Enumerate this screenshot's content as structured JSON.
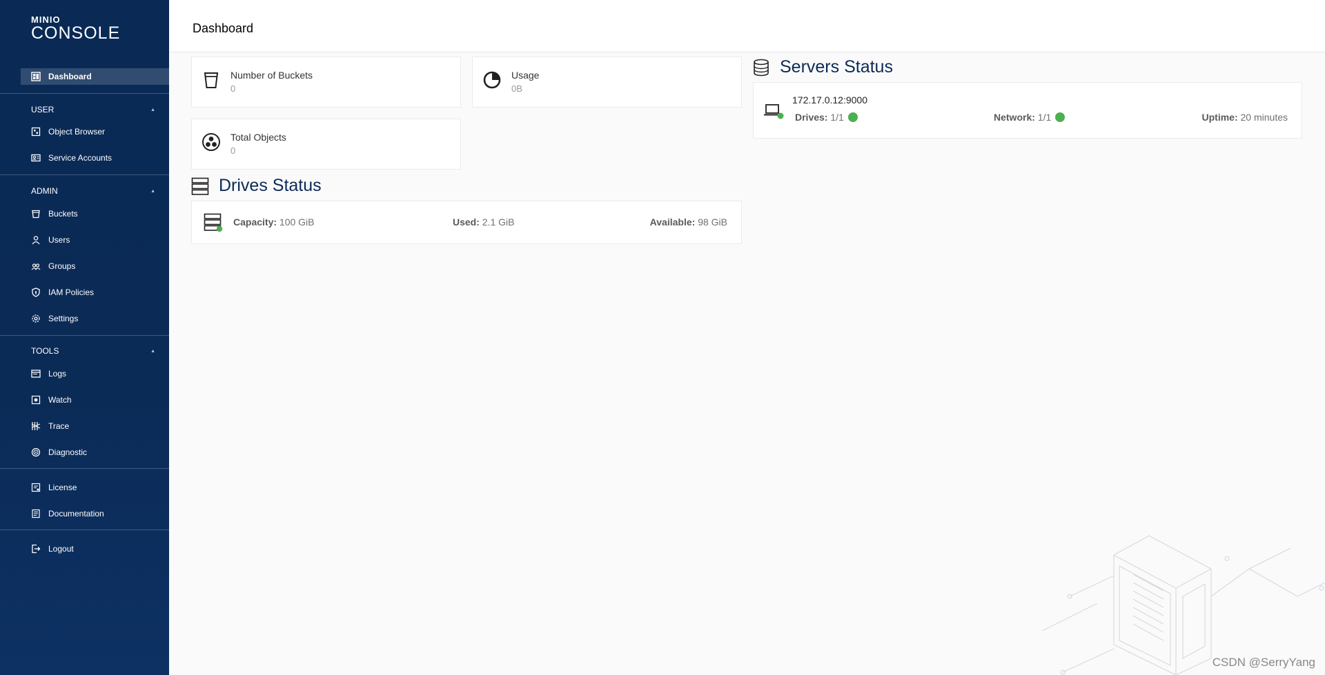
{
  "brand": {
    "small": "MINIO",
    "big": "CONSOLE"
  },
  "page": {
    "title": "Dashboard"
  },
  "sidebar": {
    "dashboard": {
      "label": "Dashboard",
      "icon": "dashboard-icon"
    },
    "sections": {
      "user": {
        "title": "USER",
        "items": [
          {
            "label": "Object Browser",
            "icon": "object-browser-icon"
          },
          {
            "label": "Service Accounts",
            "icon": "service-accounts-icon"
          }
        ]
      },
      "admin": {
        "title": "ADMIN",
        "items": [
          {
            "label": "Buckets",
            "icon": "bucket-icon"
          },
          {
            "label": "Users",
            "icon": "user-icon"
          },
          {
            "label": "Groups",
            "icon": "groups-icon"
          },
          {
            "label": "IAM Policies",
            "icon": "shield-icon"
          },
          {
            "label": "Settings",
            "icon": "gear-icon"
          }
        ]
      },
      "tools": {
        "title": "TOOLS",
        "items": [
          {
            "label": "Logs",
            "icon": "logs-icon"
          },
          {
            "label": "Watch",
            "icon": "watch-icon"
          },
          {
            "label": "Trace",
            "icon": "trace-icon"
          },
          {
            "label": "Diagnostic",
            "icon": "diagnostic-icon"
          }
        ]
      }
    },
    "extra": [
      {
        "label": "License",
        "icon": "license-icon"
      },
      {
        "label": "Documentation",
        "icon": "documentation-icon"
      }
    ],
    "logout": {
      "label": "Logout",
      "icon": "logout-icon"
    }
  },
  "stats": {
    "buckets": {
      "label": "Number of Buckets",
      "value": "0"
    },
    "usage": {
      "label": "Usage",
      "value": "0B"
    },
    "objects": {
      "label": "Total Objects",
      "value": "0"
    }
  },
  "drives": {
    "title": "Drives Status",
    "capacity_label": "Capacity:",
    "capacity_value": "100 GiB",
    "used_label": "Used:",
    "used_value": "2.1 GiB",
    "available_label": "Available:",
    "available_value": "98 GiB"
  },
  "servers": {
    "title": "Servers Status",
    "host": "172.17.0.12:9000",
    "drives_label": "Drives:",
    "drives_value": "1/1",
    "network_label": "Network:",
    "network_value": "1/1",
    "uptime_label": "Uptime:",
    "uptime_value": "20 minutes"
  },
  "colors": {
    "sidebar_bg": "#0b2b57",
    "title_color": "#0b2b57",
    "status_ok": "#4caf50"
  },
  "watermark": "CSDN @SerryYang"
}
